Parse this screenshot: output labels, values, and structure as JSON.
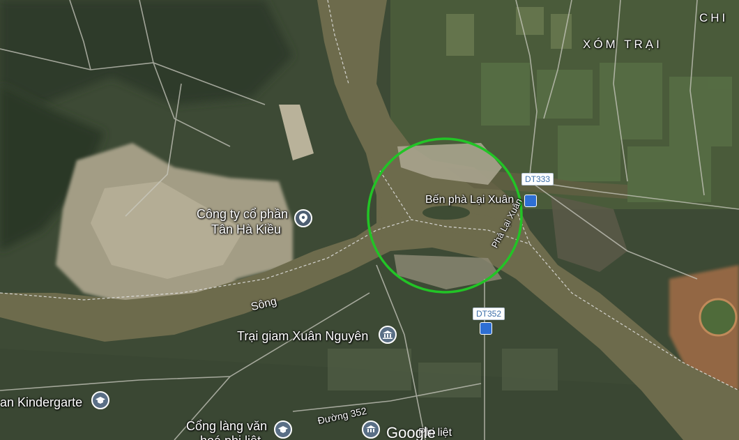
{
  "map": {
    "type": "satellite",
    "highlight_color": "#22c426",
    "labels": {
      "chi": "CHI",
      "xom_trai": "XÓM TRẠI",
      "ben_pha": "Bến phà Lại Xuân",
      "cong_ty_line1": "Công ty cổ phần",
      "cong_ty_line2": "Tân Hà Kiều",
      "song": "Sông",
      "trai_giam": "Trại giam Xuân Nguyên",
      "kindergarten": "an Kindergarte",
      "duong352": "Đường 352",
      "pha_lai_xuan": "Phà Lại Xuân",
      "cong_lang_line1": "Cổng làng văn",
      "cong_lang_line2": "hoá phi liệt",
      "bottom_partial": "Phi liệt"
    },
    "road_shields": {
      "dt333": "DT333",
      "dt352": "DT352"
    },
    "icons": {
      "cong_ty_pin": "location-pin-icon",
      "trai_giam_pin": "landmark-icon",
      "kindergarten_pin": "school-icon",
      "cong_lang_pin": "school-icon",
      "ferry": "ferry-icon",
      "bus": "bus-icon"
    },
    "attribution": "Google"
  }
}
